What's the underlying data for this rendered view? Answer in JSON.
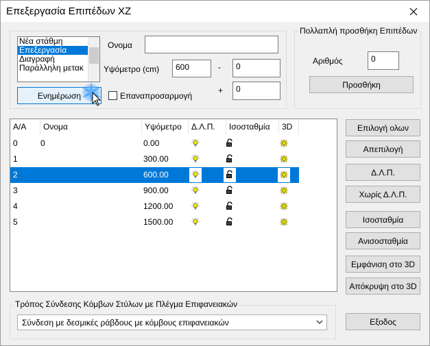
{
  "window": {
    "title": "Επεξεργασία Επιπέδων XZ"
  },
  "mode_list": {
    "items": [
      "Νέα στάθμη",
      "Επεξεργασία",
      "Διαγραφή",
      "Παράλληλη μετακ"
    ],
    "selected_index": 1
  },
  "fields": {
    "name_label": "Ονομα",
    "name_value": "",
    "height_label": "Υψόμετρο (cm)",
    "height_value": "600",
    "minus_label": "-",
    "minus_value": "0",
    "plus_label": "+",
    "plus_value": "0"
  },
  "buttons": {
    "update": "Ενημέρωση",
    "readjust_label": "Επαναπροσαρμογή",
    "add": "Προσθήκη",
    "select_all": "Επιλογή ολων",
    "deselect": "Απεπιλογή",
    "dlp": "Δ.Λ.Π.",
    "no_dlp": "Χωρίς Δ.Λ.Π.",
    "isostathmia": "Ισοσταθμία",
    "anisostathmia": "Ανισοσταθμία",
    "show_3d": "Εμφάνιση στο 3D",
    "hide_3d": "Απόκρυψη στο 3D",
    "exit": "Εξοδος"
  },
  "multi_add": {
    "group_label": "Πολλαπλή προσθήκη Επιπέδων",
    "count_label": "Αριθμός",
    "count_value": "0"
  },
  "table": {
    "headers": [
      "Α/Α",
      "Ονομα",
      "Υψόμετρο",
      "Δ.Λ.Π.",
      "Ισοσταθμία",
      "3D"
    ],
    "rows": [
      {
        "aa": "0",
        "name": "0",
        "height": "0.00"
      },
      {
        "aa": "1",
        "name": "",
        "height": "300.00"
      },
      {
        "aa": "2",
        "name": "",
        "height": "600.00"
      },
      {
        "aa": "3",
        "name": "",
        "height": "900.00"
      },
      {
        "aa": "4",
        "name": "",
        "height": "1200.00"
      },
      {
        "aa": "5",
        "name": "",
        "height": "1500.00"
      }
    ],
    "selected_index": 2
  },
  "connection": {
    "group_label": "Τρόπος Σύνδεσης Κόμβων Στύλων με Πλέγμα Επιφανειακών",
    "selected": "Σύνδεση με δεσμικές ράβδους με κόμβους επιφανειακών"
  },
  "colors": {
    "accent": "#0078d7",
    "bulb": "#f4e600"
  }
}
